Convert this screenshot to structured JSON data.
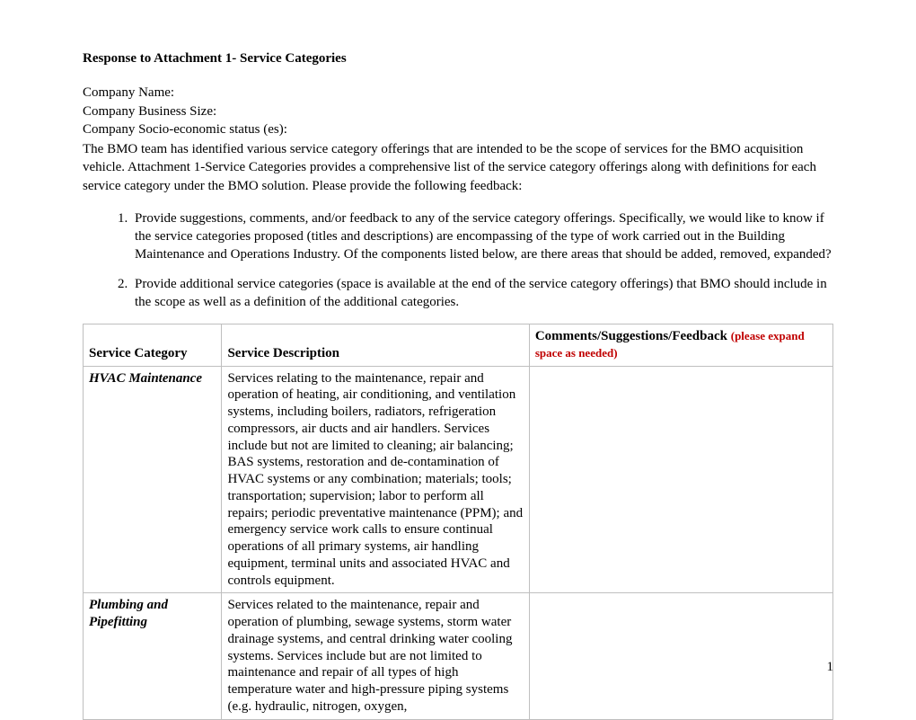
{
  "title": "Response to Attachment 1- Service Categories",
  "fields": {
    "company_name_label": "Company Name:",
    "business_size_label": "Company Business Size:",
    "socio_label": "Company Socio-economic status (es):"
  },
  "intro": "The BMO team has identified various service category offerings that are intended to be the scope of services for the BMO acquisition vehicle. Attachment 1-Service Categories provides a comprehensive list of the service category offerings along with definitions for each service category under the BMO solution. Please provide the following feedback:",
  "list": {
    "item1": "Provide suggestions, comments, and/or feedback to any of the service category offerings. Specifically, we would like to know if the service categories proposed (titles and descriptions) are encompassing of the type of work carried out in the Building Maintenance and Operations Industry. Of the components listed below, are there areas that should be added, removed, expanded?",
    "item2": "Provide additional service categories (space is available at the end of the service category offerings) that BMO should include in the scope as well as a definition of the additional categories."
  },
  "table": {
    "headers": {
      "col1": "Service Category",
      "col2": "Service Description",
      "col3_main": "Comments/Suggestions/Feedback ",
      "col3_note": "(please expand space as needed)"
    },
    "rows": [
      {
        "category": "HVAC Maintenance",
        "description": "Services relating to the maintenance, repair and operation of heating, air conditioning, and ventilation systems, including boilers, radiators, refrigeration compressors, air ducts and air handlers. Services include but not are limited to cleaning; air balancing; BAS systems, restoration and de-contamination of HVAC systems or any combination; materials; tools; transportation; supervision; labor to perform all repairs; periodic preventative maintenance (PPM); and emergency service work calls to ensure continual operations of all primary systems, air handling equipment, terminal units and associated HVAC and controls equipment.",
        "comments": ""
      },
      {
        "category": "Plumbing and Pipefitting",
        "description": "Services related to the maintenance, repair and operation of plumbing, sewage systems, storm water drainage systems, and central drinking water cooling systems. Services include but are not limited to maintenance and repair of all types of high temperature water and high-pressure piping systems (e.g. hydraulic, nitrogen, oxygen,",
        "comments": ""
      }
    ]
  },
  "page_number": "1"
}
